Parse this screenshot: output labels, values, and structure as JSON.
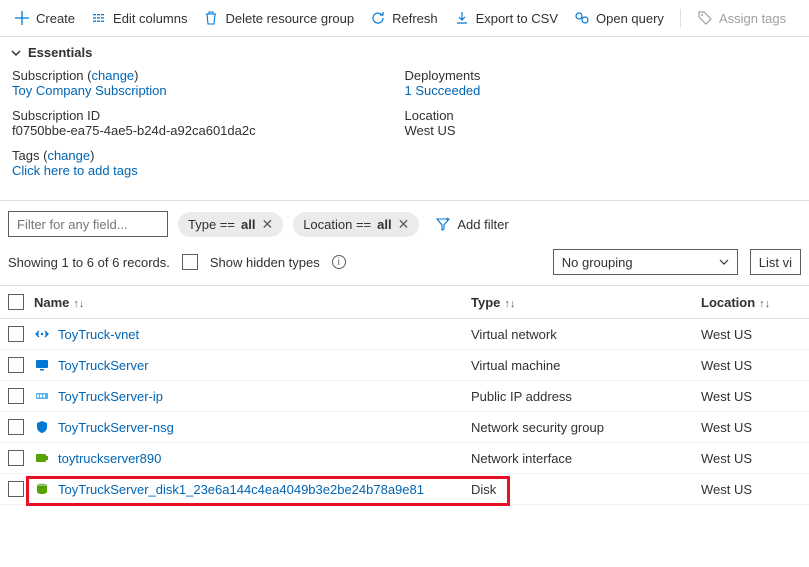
{
  "toolbar": {
    "create": "Create",
    "edit_columns": "Edit columns",
    "delete_rg": "Delete resource group",
    "refresh": "Refresh",
    "export_csv": "Export to CSV",
    "open_query": "Open query",
    "assign_tags": "Assign tags"
  },
  "essentials": {
    "header": "Essentials",
    "subscription_label": "Subscription",
    "change_label": "change",
    "subscription_name": "Toy Company Subscription",
    "subscription_id_label": "Subscription ID",
    "subscription_id": "f0750bbe-ea75-4ae5-b24d-a92ca601da2c",
    "tags_label": "Tags",
    "tags_link": "Click here to add tags",
    "deployments_label": "Deployments",
    "deployments_value": "1 Succeeded",
    "location_label": "Location",
    "location_value": "West US"
  },
  "filters": {
    "placeholder": "Filter for any field...",
    "type_prefix": "Type == ",
    "type_value": "all",
    "location_prefix": "Location == ",
    "location_value": "all",
    "add_filter": "Add filter"
  },
  "controls": {
    "count_text": "Showing 1 to 6 of 6 records.",
    "show_hidden": "Show hidden types",
    "grouping": "No grouping",
    "list_view": "List vi"
  },
  "columns": {
    "name": "Name",
    "type": "Type",
    "location": "Location"
  },
  "rows": [
    {
      "name": "ToyTruck-vnet",
      "type": "Virtual network",
      "location": "West US",
      "icon": "vnet",
      "color": "#0078d4"
    },
    {
      "name": "ToyTruckServer",
      "type": "Virtual machine",
      "location": "West US",
      "icon": "vm",
      "color": "#0078d4"
    },
    {
      "name": "ToyTruckServer-ip",
      "type": "Public IP address",
      "location": "West US",
      "icon": "ip",
      "color": "#0078d4"
    },
    {
      "name": "ToyTruckServer-nsg",
      "type": "Network security group",
      "location": "West US",
      "icon": "nsg",
      "color": "#0078d4"
    },
    {
      "name": "toytruckserver890",
      "type": "Network interface",
      "location": "West US",
      "icon": "nic",
      "color": "#57a300"
    },
    {
      "name": "ToyTruckServer_disk1_23e6a144c4ea4049b3e2be24b78a9e81",
      "type": "Disk",
      "location": "West US",
      "icon": "disk",
      "color": "#57a300",
      "highlight": true
    }
  ]
}
